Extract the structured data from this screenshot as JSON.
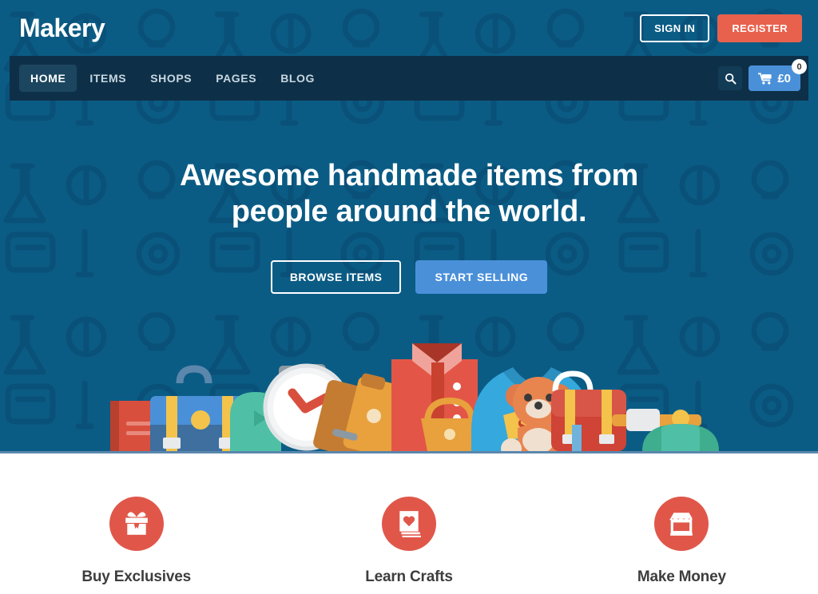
{
  "site": {
    "logo": "Makery",
    "accent_blue": "#0b5c85",
    "nav_blue": "#0d3048",
    "accent_red": "#e8614d",
    "accent_light_blue": "#4a90d9",
    "feature_circle_red": "#e0574a"
  },
  "topbar": {
    "sign_in_label": "SIGN IN",
    "register_label": "REGISTER"
  },
  "nav": {
    "items": [
      {
        "label": "HOME",
        "active": true
      },
      {
        "label": "ITEMS",
        "active": false
      },
      {
        "label": "SHOPS",
        "active": false
      },
      {
        "label": "PAGES",
        "active": false
      },
      {
        "label": "BLOG",
        "active": false
      }
    ],
    "search_icon": "search-icon",
    "cart": {
      "icon": "shopping-cart-icon",
      "amount": "£0",
      "badge_count": "0"
    }
  },
  "hero": {
    "title_line1": "Awesome handmade items from",
    "title_line2": "people around the world.",
    "browse_label": "BROWSE ITEMS",
    "sell_label": "START SELLING"
  },
  "features": [
    {
      "icon": "gift-box-icon",
      "title": "Buy Exclusives"
    },
    {
      "icon": "book-heart-icon",
      "title": "Learn Crafts"
    },
    {
      "icon": "storefront-icon",
      "title": "Make Money"
    }
  ]
}
